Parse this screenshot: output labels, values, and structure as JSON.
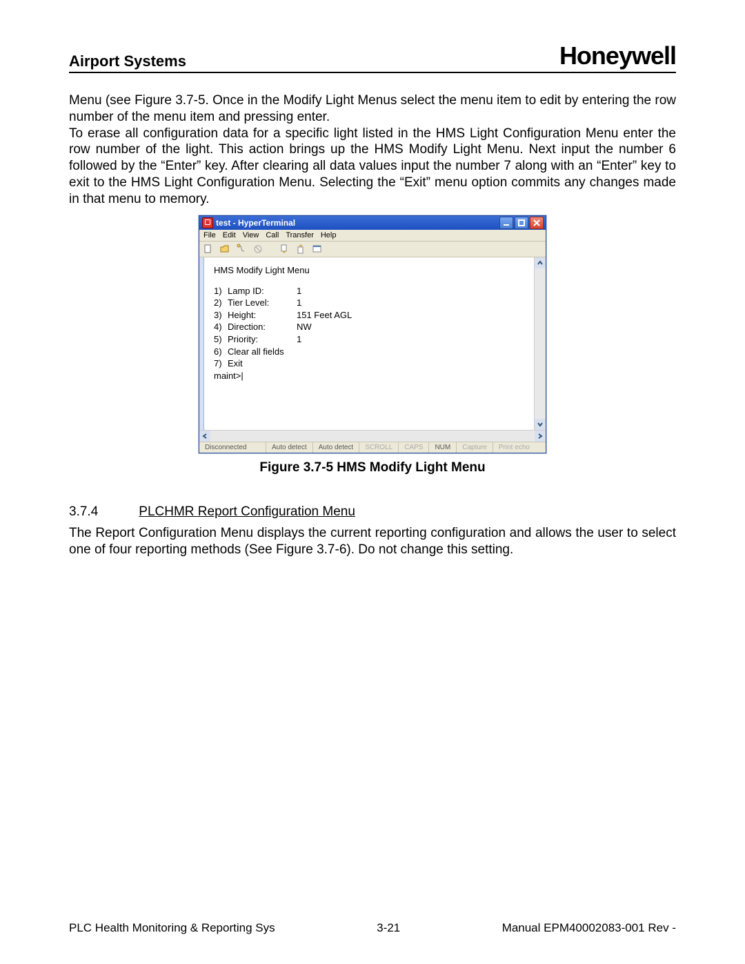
{
  "header": {
    "left": "Airport Systems",
    "right": "Honeywell"
  },
  "paragraphs": {
    "p1": "Menu (see Figure 3.7-5.  Once in the Modify Light Menus select the menu item to edit by entering the row number of the menu item and pressing enter.",
    "p2": "To erase all configuration data for a specific light listed in the HMS Light Configuration Menu enter the row number of the light.  This action brings up the HMS Modify Light Menu.  Next input the number 6 followed by the “Enter” key.  After clearing all data values input the number 7 along with an “Enter” key to exit to the HMS Light Configuration Menu.  Selecting the “Exit” menu option commits any changes made in that menu to memory."
  },
  "hyperterminal": {
    "title": "test - HyperTerminal",
    "menubar": [
      "File",
      "Edit",
      "View",
      "Call",
      "Transfer",
      "Help"
    ],
    "terminal_title": "HMS Modify Light Menu",
    "rows": [
      {
        "n": "1)",
        "label": "Lamp ID:",
        "value": "1"
      },
      {
        "n": "2)",
        "label": "Tier Level:",
        "value": "1"
      },
      {
        "n": "3)",
        "label": "Height:",
        "value": "151 Feet AGL"
      },
      {
        "n": "4)",
        "label": "Direction:",
        "value": "NW"
      },
      {
        "n": "5)",
        "label": "Priority:",
        "value": "1"
      },
      {
        "n": "6)",
        "label": "Clear all fields",
        "value": ""
      },
      {
        "n": "7)",
        "label": "Exit",
        "value": ""
      }
    ],
    "prompt": "maint>|",
    "status": {
      "conn": "Disconnected",
      "detect1": "Auto detect",
      "detect2": "Auto detect",
      "scroll": "SCROLL",
      "caps": "CAPS",
      "num": "NUM",
      "capture": "Capture",
      "echo": "Print echo"
    }
  },
  "figure_caption": "Figure 3.7-5 HMS Modify Light Menu",
  "section": {
    "num": "3.7.4",
    "title": "PLCHMR Report Configuration Menu",
    "body": "The Report Configuration Menu displays the current reporting configuration and allows the user to select one of four reporting methods (See Figure 3.7-6).  Do not change this setting."
  },
  "footer": {
    "left": "PLC Health Monitoring & Reporting Sys",
    "center": "3-21",
    "right": "Manual EPM40002083-001 Rev -"
  }
}
